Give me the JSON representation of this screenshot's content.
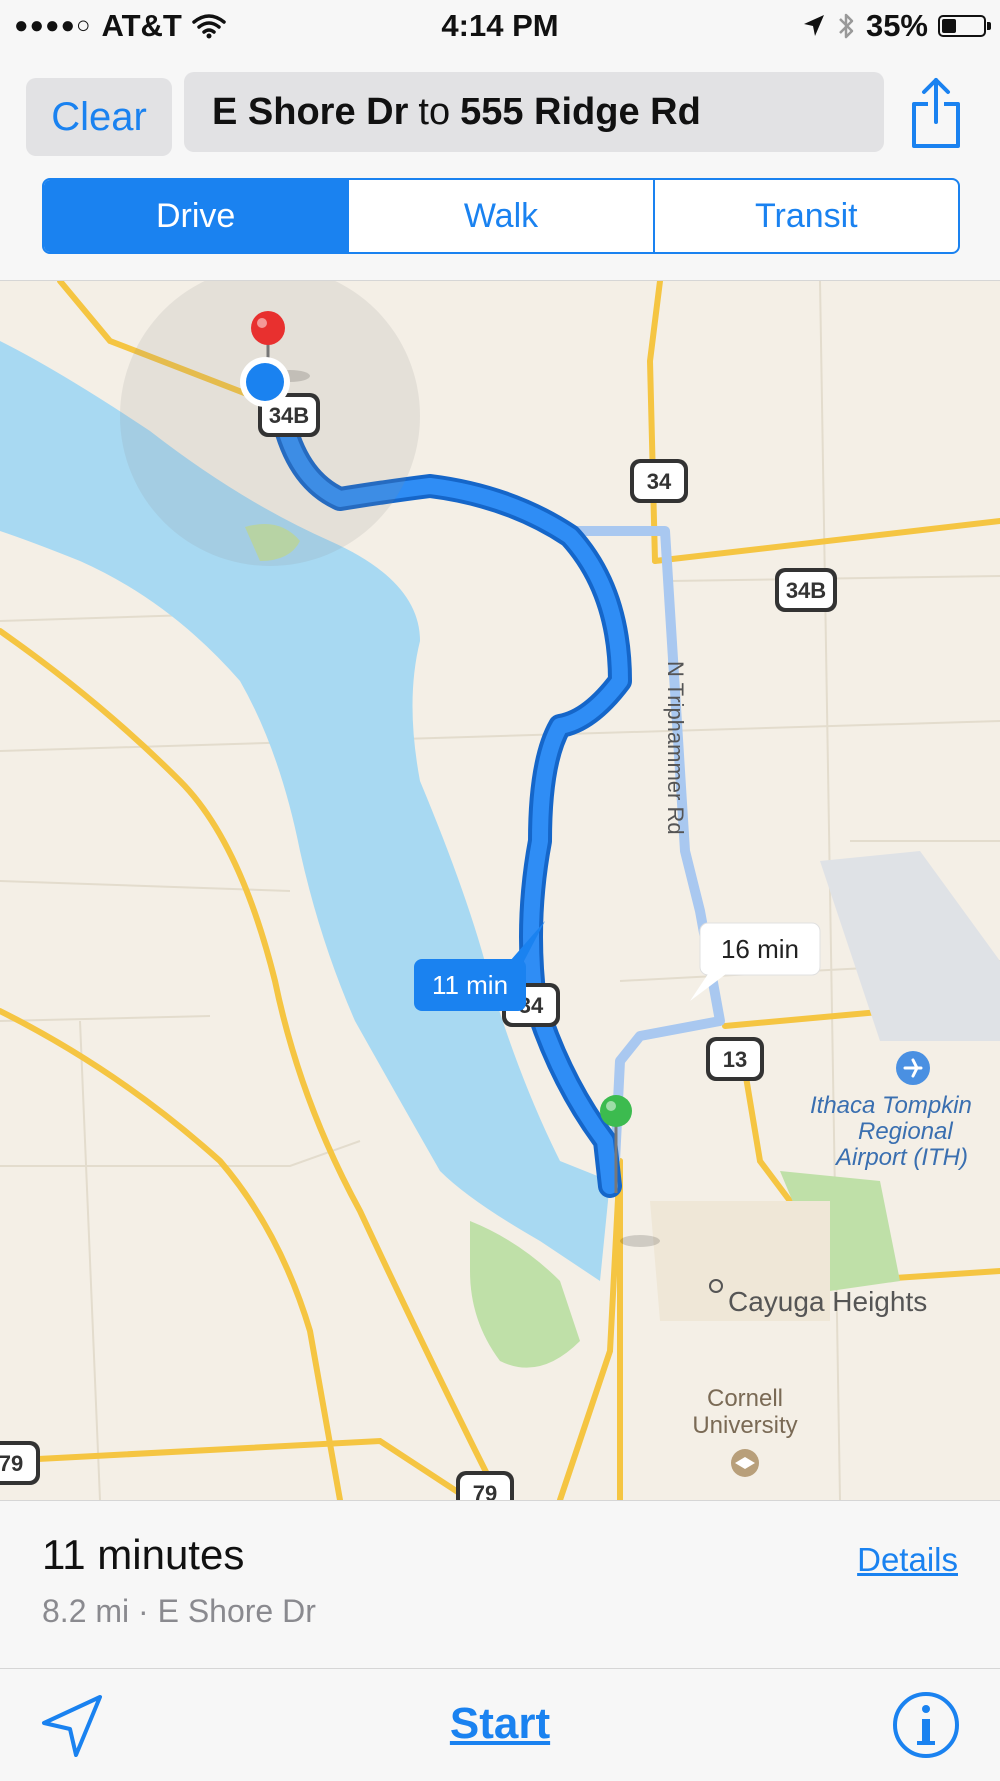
{
  "status": {
    "carrier": "AT&T",
    "time": "4:14 PM",
    "battery": "35%",
    "battery_level": 0.35,
    "icons": [
      "signal-dots-icon",
      "wifi-icon",
      "location-arrow-icon",
      "bluetooth-icon",
      "battery-icon"
    ]
  },
  "nav": {
    "clear_label": "Clear",
    "route_from": "E Shore Dr",
    "route_connector": "to",
    "route_to": "555 Ridge Rd",
    "share_icon": "share-icon"
  },
  "modes": [
    {
      "label": "Drive",
      "active": true
    },
    {
      "label": "Walk",
      "active": false
    },
    {
      "label": "Transit",
      "active": false
    }
  ],
  "map": {
    "route_primary_label": "11 min",
    "route_alt_label": "16 min",
    "street_label": "N Triphammer Rd",
    "airport_label_line1": "Ithaca Tompkin",
    "airport_label_line2": "Regional",
    "airport_label_line3": "Airport (ITH)",
    "place_cayuga": "Cayuga Heights",
    "place_cornell_line1": "Cornell",
    "place_cornell_line2": "University",
    "shields": [
      "34B",
      "34",
      "34B",
      "34",
      "13",
      "79",
      "79"
    ],
    "colors": {
      "water": "#a8d9f2",
      "land": "#f4efe6",
      "primary_route": "#1a82f0",
      "alt_route": "#a9c8f0",
      "highway": "#f5c542"
    }
  },
  "summary": {
    "duration": "11 minutes",
    "distance_info": "8.2 mi · E Shore Dr",
    "details_label": "Details"
  },
  "toolbar": {
    "start_label": "Start",
    "locate_icon": "location-arrow-icon",
    "info_icon": "info-icon"
  }
}
